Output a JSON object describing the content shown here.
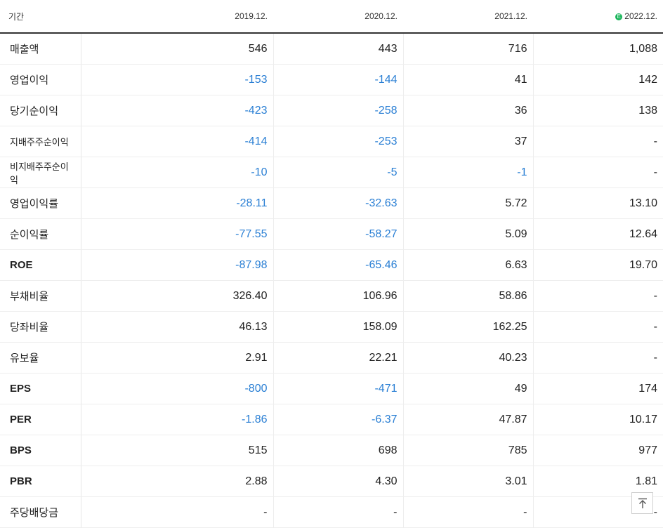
{
  "header": {
    "label": "기간",
    "periods": [
      "2019.12.",
      "2020.12.",
      "2021.12.",
      "2022.12."
    ],
    "estimate_badge": "E"
  },
  "rows": [
    {
      "label": "매출액",
      "values": [
        "546",
        "443",
        "716",
        "1,088"
      ]
    },
    {
      "label": "영업이익",
      "values": [
        "-153",
        "-144",
        "41",
        "142"
      ]
    },
    {
      "label": "당기순이익",
      "values": [
        "-423",
        "-258",
        "36",
        "138"
      ]
    },
    {
      "label": "지배주주순이익",
      "values": [
        "-414",
        "-253",
        "37",
        "-"
      ]
    },
    {
      "label": "비지배주주순이익",
      "values": [
        "-10",
        "-5",
        "-1",
        "-"
      ]
    },
    {
      "label": "영업이익률",
      "values": [
        "-28.11",
        "-32.63",
        "5.72",
        "13.10"
      ]
    },
    {
      "label": "순이익률",
      "values": [
        "-77.55",
        "-58.27",
        "5.09",
        "12.64"
      ]
    },
    {
      "label": "ROE",
      "values": [
        "-87.98",
        "-65.46",
        "6.63",
        "19.70"
      ]
    },
    {
      "label": "부채비율",
      "values": [
        "326.40",
        "106.96",
        "58.86",
        "-"
      ]
    },
    {
      "label": "당좌비율",
      "values": [
        "46.13",
        "158.09",
        "162.25",
        "-"
      ]
    },
    {
      "label": "유보율",
      "values": [
        "2.91",
        "22.21",
        "40.23",
        "-"
      ]
    },
    {
      "label": "EPS",
      "values": [
        "-800",
        "-471",
        "49",
        "174"
      ]
    },
    {
      "label": "PER",
      "values": [
        "-1.86",
        "-6.37",
        "47.87",
        "10.17"
      ]
    },
    {
      "label": "BPS",
      "values": [
        "515",
        "698",
        "785",
        "977"
      ]
    },
    {
      "label": "PBR",
      "values": [
        "2.88",
        "4.30",
        "3.01",
        "1.81"
      ]
    },
    {
      "label": "주당배당금",
      "values": [
        "-",
        "-",
        "-",
        "-"
      ]
    }
  ],
  "colors": {
    "negative": "#2a7fd4",
    "estimate_badge": "#19b55a"
  },
  "scroll_top_icon": "arrow-up-to-top-icon"
}
